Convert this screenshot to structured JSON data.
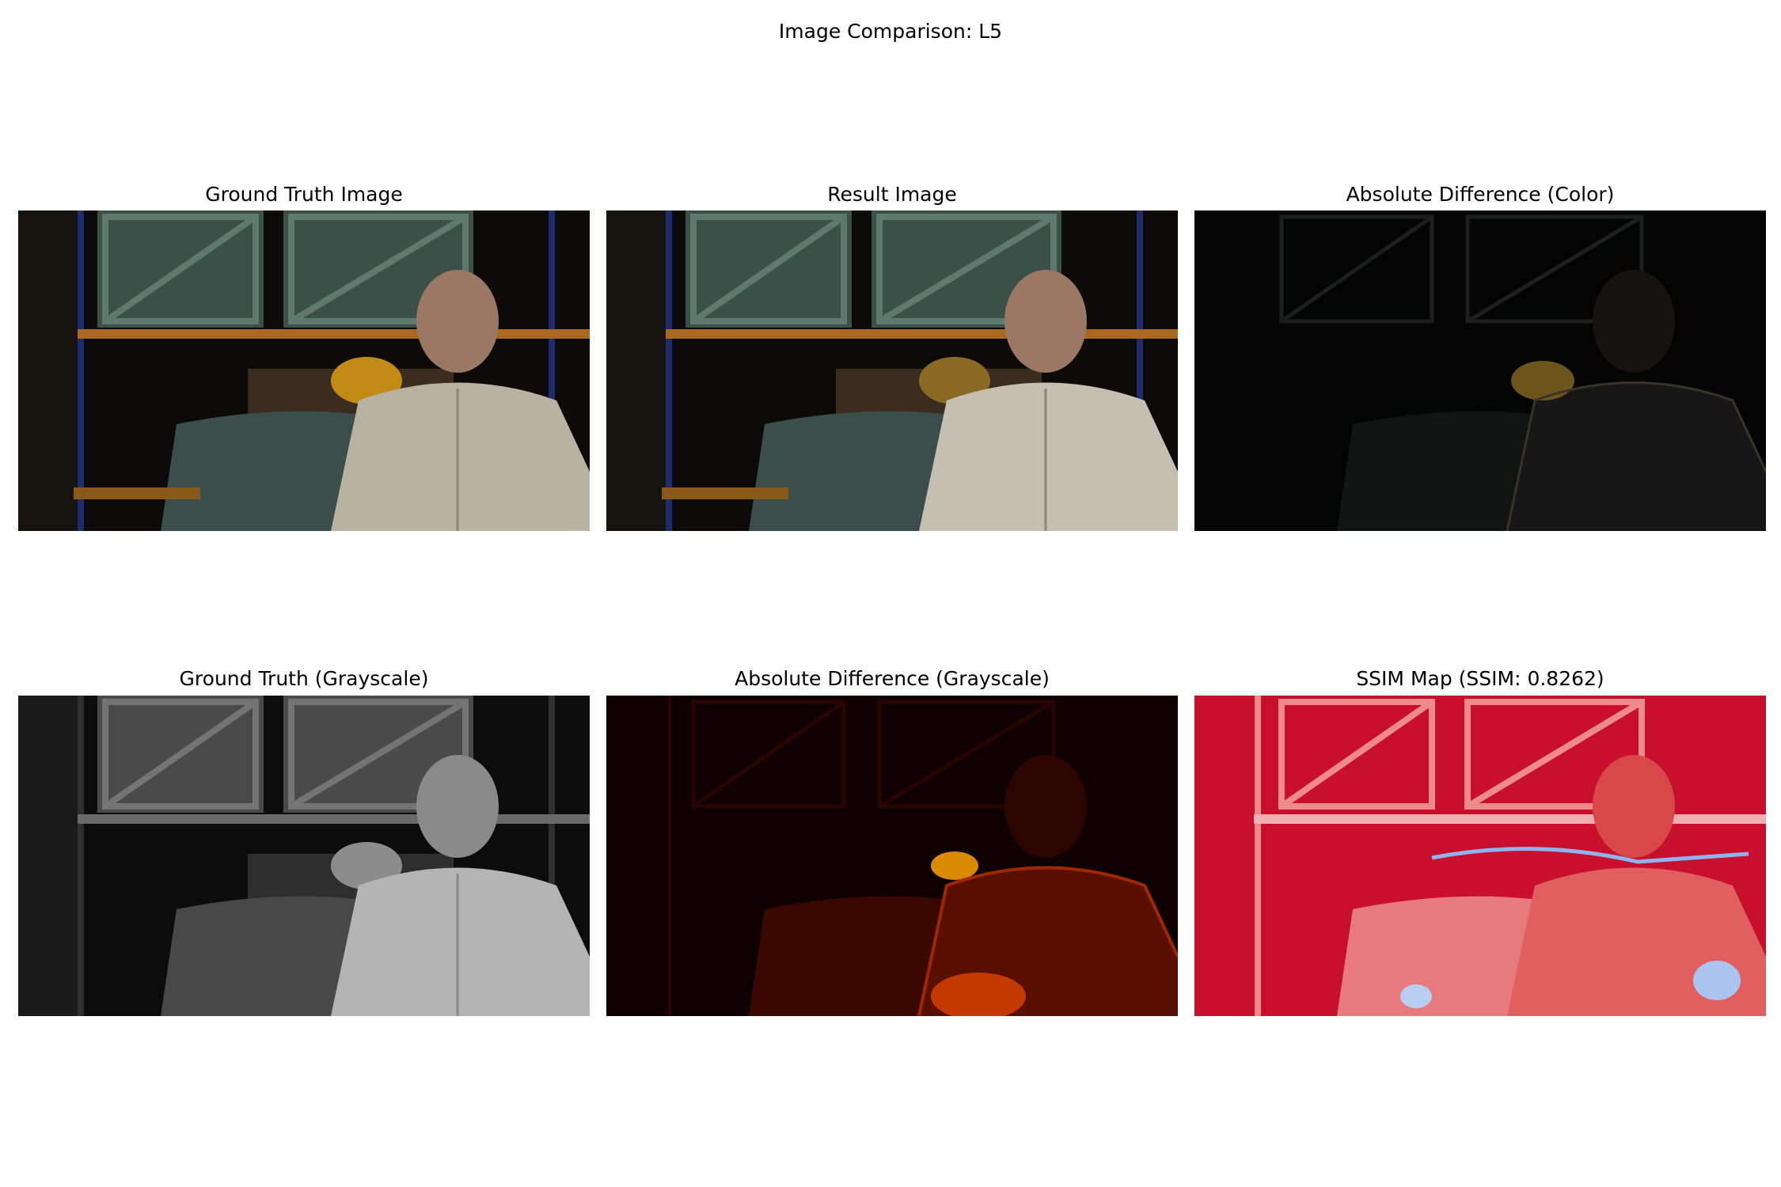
{
  "figure": {
    "title": "Image Comparison: L5"
  },
  "panels": [
    {
      "title": "Ground Truth Image"
    },
    {
      "title": "Result Image"
    },
    {
      "title": "Absolute Difference (Color)"
    },
    {
      "title": "Ground Truth (Grayscale)"
    },
    {
      "title": "Absolute Difference (Grayscale)"
    },
    {
      "title": "SSIM Map (SSIM: 0.8262)"
    }
  ]
}
